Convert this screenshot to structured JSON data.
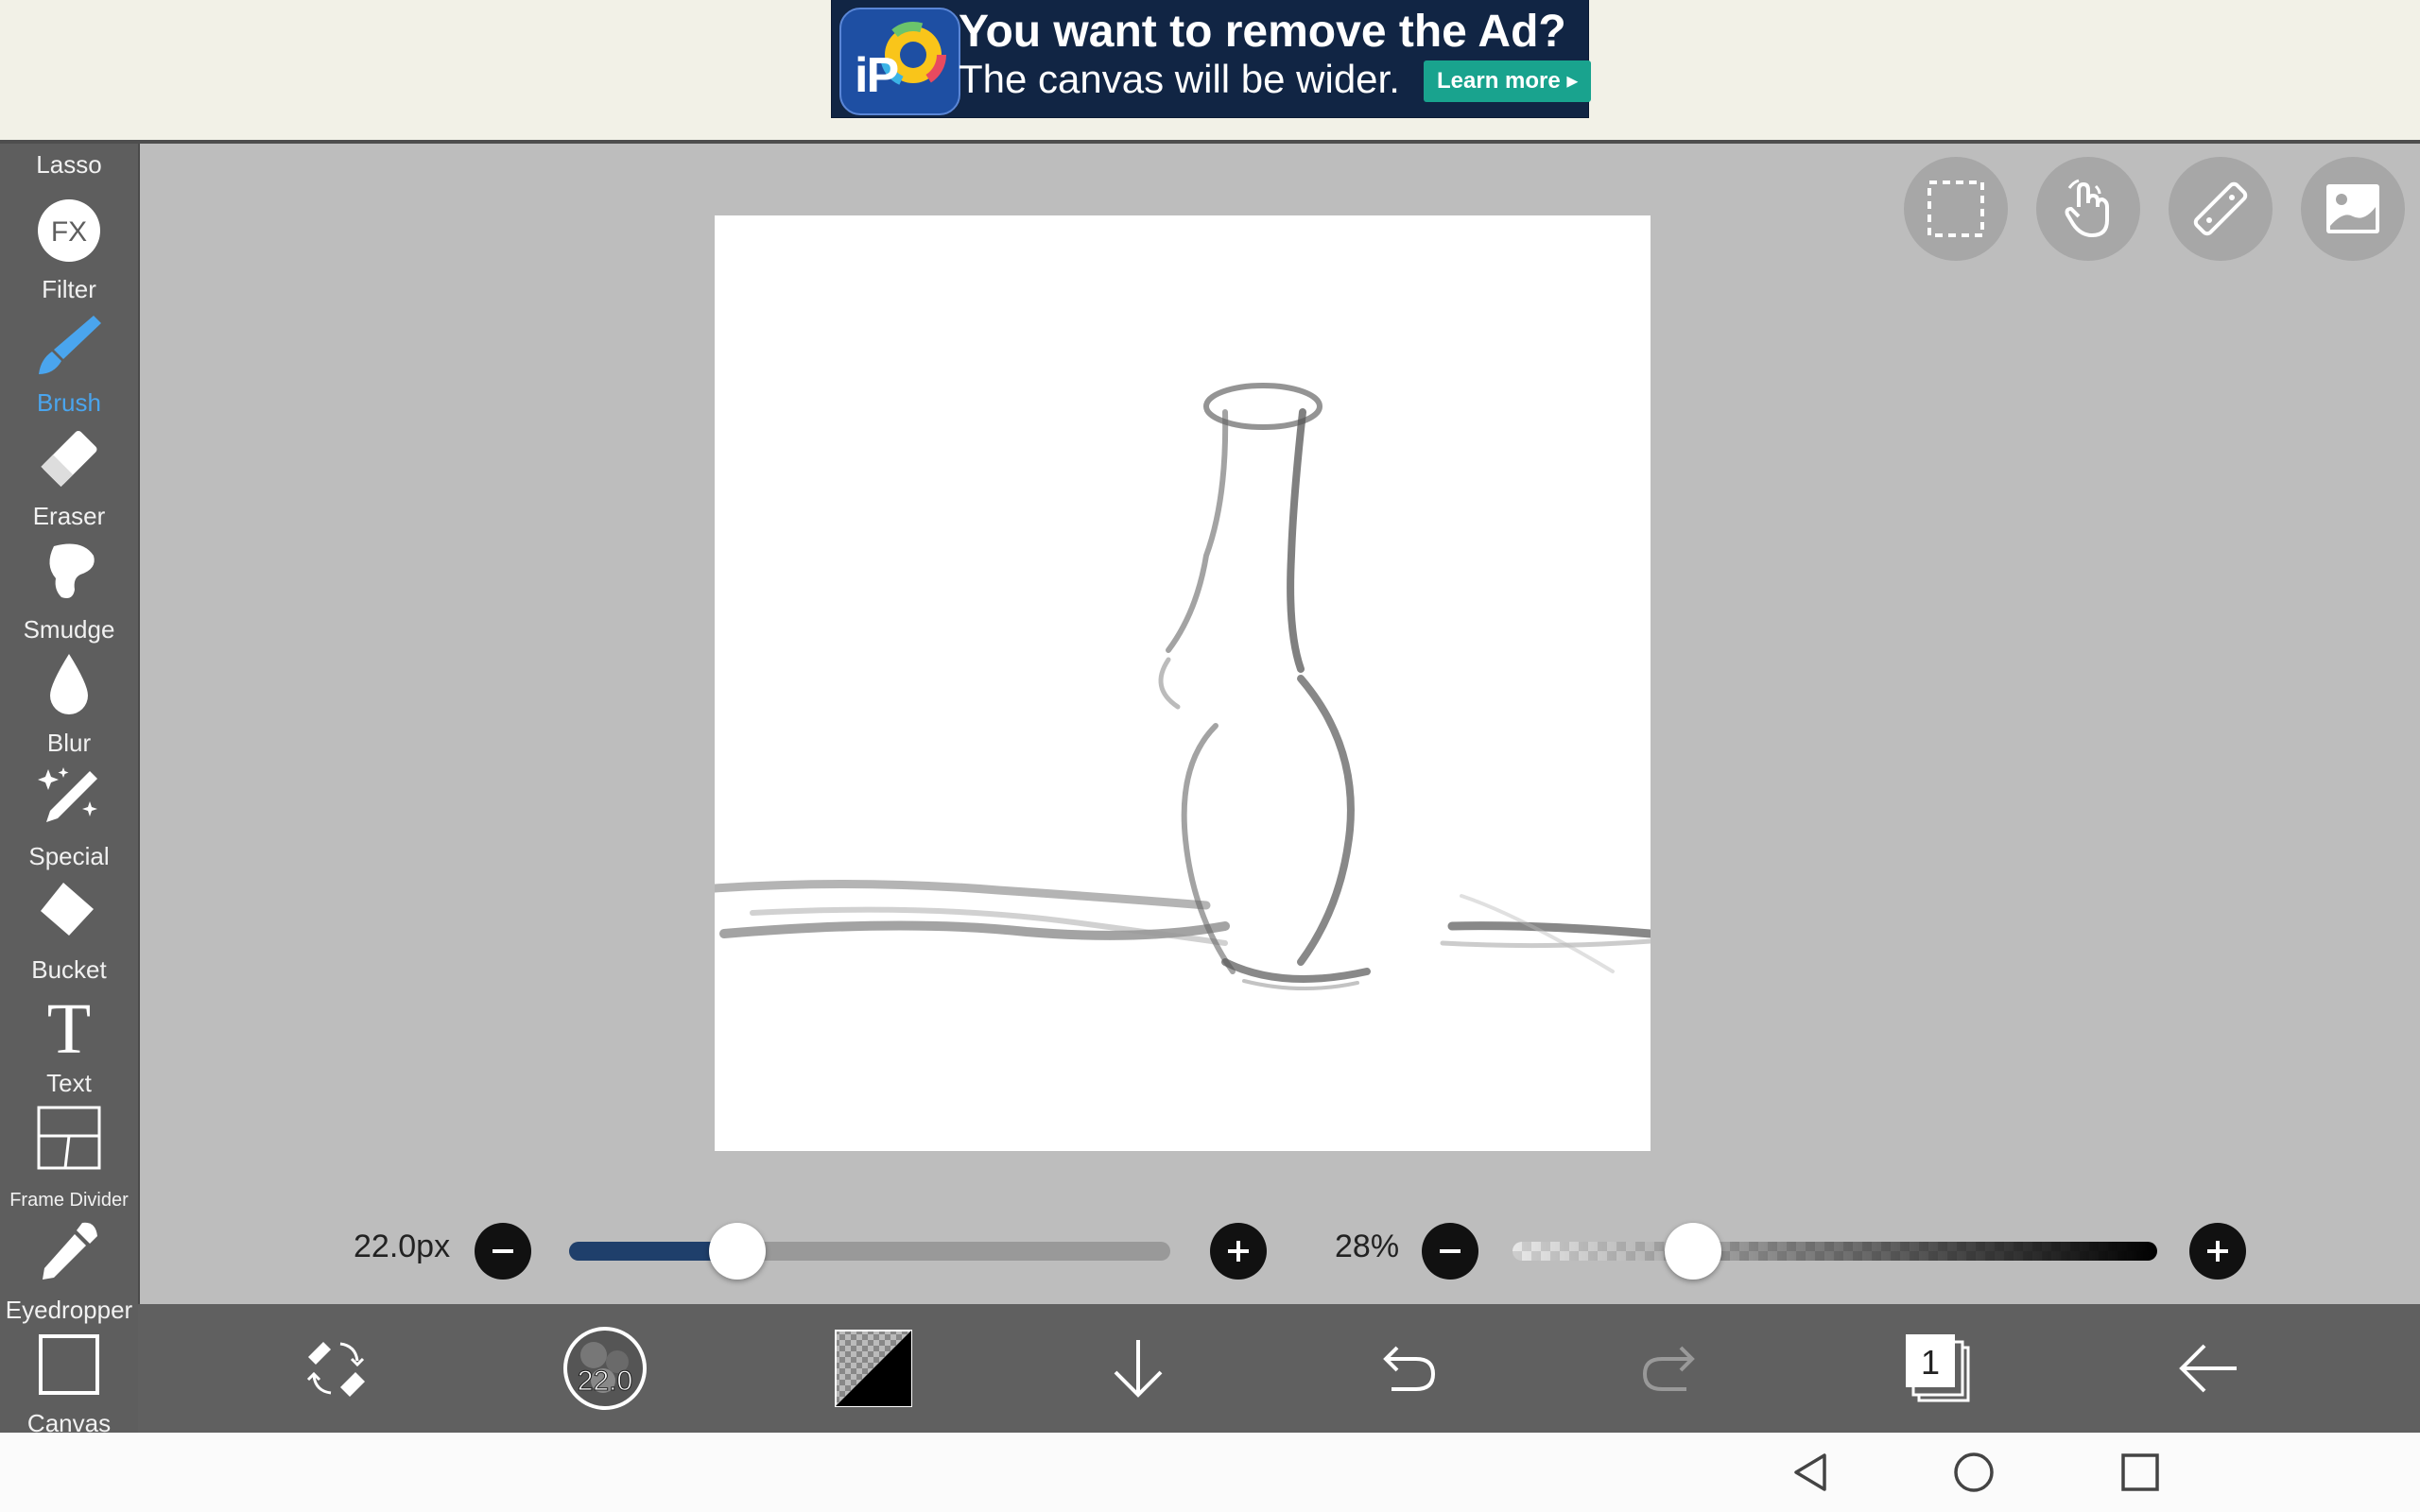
{
  "ad": {
    "logo_text": "iP",
    "title": "You want to remove the Ad?",
    "subtitle": "The canvas will be wider.",
    "button": "Learn more ▸"
  },
  "toolbar": {
    "items": [
      {
        "label": "Lasso",
        "icon": "lasso-icon"
      },
      {
        "label": "Filter",
        "icon": "fx-icon",
        "icon_text": "FX"
      },
      {
        "label": "Brush",
        "icon": "brush-icon",
        "active": true
      },
      {
        "label": "Eraser",
        "icon": "eraser-icon"
      },
      {
        "label": "Smudge",
        "icon": "smudge-icon"
      },
      {
        "label": "Blur",
        "icon": "blur-drop-icon"
      },
      {
        "label": "Special",
        "icon": "special-sparkle-pen-icon"
      },
      {
        "label": "Bucket",
        "icon": "bucket-icon"
      },
      {
        "label": "Text",
        "icon": "text-t-icon",
        "icon_text": "T"
      },
      {
        "label": "Frame Divider",
        "icon": "frame-divider-icon"
      },
      {
        "label": "Eyedropper",
        "icon": "eyedropper-icon"
      },
      {
        "label": "Canvas",
        "icon": "canvas-square-icon"
      }
    ],
    "active_color": "#4aa5ee"
  },
  "quick_actions": [
    {
      "name": "selection",
      "icon": "dashed-selection-icon"
    },
    {
      "name": "hand",
      "icon": "hand-gesture-icon"
    },
    {
      "name": "ruler",
      "icon": "ruler-icon"
    },
    {
      "name": "image",
      "icon": "image-icon"
    }
  ],
  "brush_size": {
    "label": "22.0px",
    "value_fraction": 0.28,
    "fill_color": "#1f3f6b"
  },
  "opacity": {
    "label": "28%",
    "value_fraction": 0.28
  },
  "bottom_bar": {
    "brush_preview_value": "22.0",
    "layers_count": "1",
    "items": [
      "swap-brush-eraser-icon",
      "brush-preview-icon",
      "color-swatch-icon",
      "arrow-down-icon",
      "undo-icon",
      "redo-icon",
      "layers-icon",
      "back-arrow-icon"
    ]
  },
  "nav": [
    "back-triangle-icon",
    "home-circle-icon",
    "recents-square-icon"
  ]
}
